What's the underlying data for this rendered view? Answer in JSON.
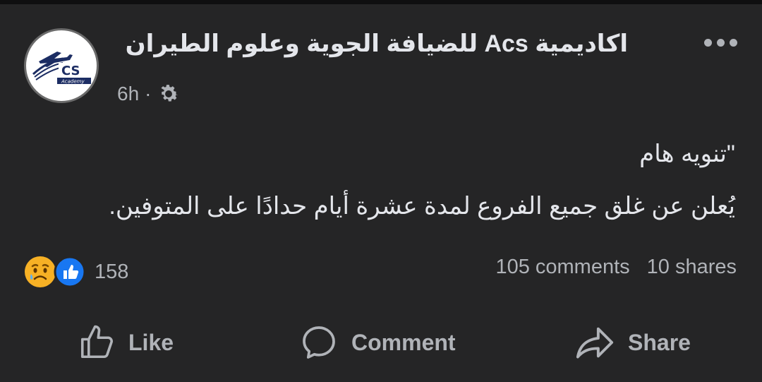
{
  "post": {
    "page_name": "اكاديمية Acs للضيافة الجوية وعلوم الطيران",
    "time": "6h",
    "separator": "·",
    "privacy_icon": "gear-icon",
    "avatar": {
      "logo_text": "CS",
      "logo_subtext": "Academy"
    },
    "text_line1": "\"تنويه هام",
    "text_line2": "يُعلن عن غلق جميع الفروع لمدة عشرة أيام حدادًا على المتوفين."
  },
  "engagement": {
    "reaction_icons": [
      "sad-emoji-icon",
      "like-reaction-icon"
    ],
    "reaction_count": "158",
    "comments": "105 comments",
    "shares": "10 shares"
  },
  "actions": {
    "like": "Like",
    "comment": "Comment",
    "share": "Share"
  },
  "colors": {
    "background": "#252526",
    "text_primary": "#e4e6eb",
    "text_secondary": "#b0b3b8",
    "like_blue": "#1877f2",
    "logo_navy": "#1c2d63"
  }
}
